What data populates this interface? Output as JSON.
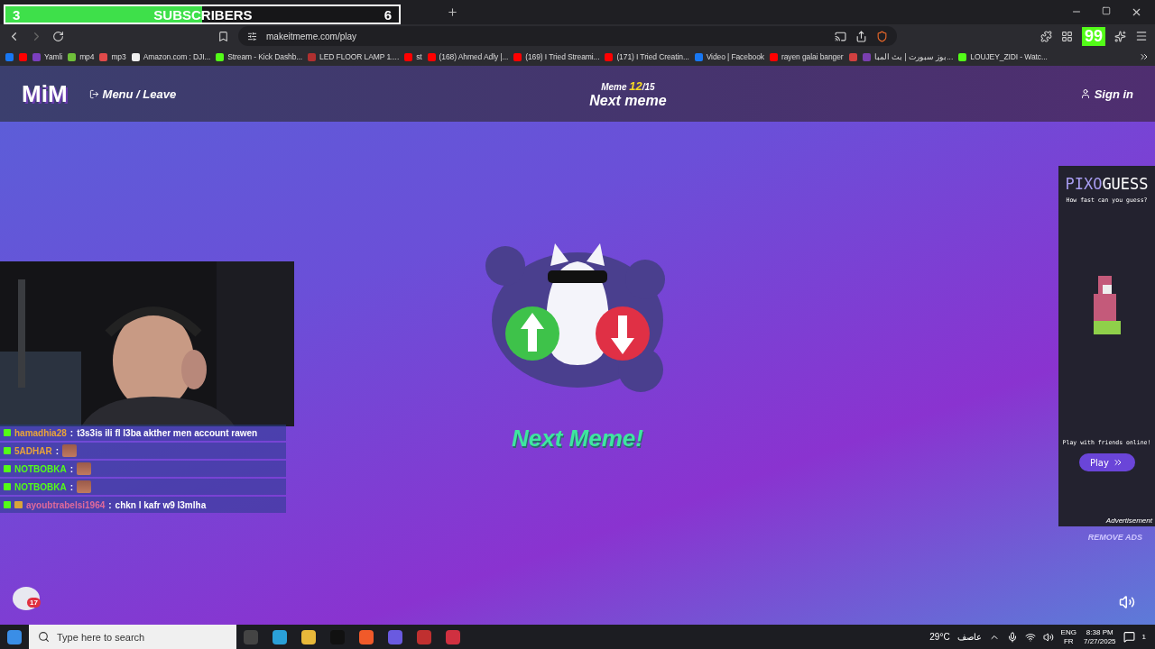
{
  "subscriber_goal": {
    "current": "3",
    "label": "SUBSCRIBERS",
    "goal": "6",
    "level": 0.5
  },
  "browser": {
    "address": "makeitmeme.com/play",
    "extension_counter": "99",
    "bookmarks": [
      {
        "color": "#1877f2"
      },
      {
        "color": "#ff0000"
      },
      {
        "label": "Yamli",
        "color": "#7b3fbf"
      },
      {
        "label": "mp4",
        "color": "#6fbf3a"
      },
      {
        "label": "mp3",
        "color": "#e04a4a"
      },
      {
        "label": "Amazon.com : DJI...",
        "color": "#f0f0f0"
      },
      {
        "label": "Stream - Kick Dashb...",
        "color": "#53fc18"
      },
      {
        "label": "LED FLOOR LAMP 1....",
        "color": "#b03030"
      },
      {
        "label": "st",
        "color": "#ff0000"
      },
      {
        "label": "(168) Ahmed Adly |...",
        "color": "#ff0000"
      },
      {
        "label": "(169) I Tried Streami...",
        "color": "#ff0000"
      },
      {
        "label": "(171) I Tried Creatin...",
        "color": "#ff0000"
      },
      {
        "label": "Video | Facebook",
        "color": "#1877f2"
      },
      {
        "label": "rayen galai banger",
        "color": "#ff0000"
      },
      {
        "color": "#d04040"
      },
      {
        "label": "بوز سبورت | بث المبا...",
        "color": "#7a3fb0"
      },
      {
        "label": "LOUJEY_ZIDI - Watc...",
        "color": "#53fc18"
      }
    ]
  },
  "header": {
    "logo": "MiM",
    "menu": "Menu / Leave",
    "counter_label": "Meme",
    "counter_current": "12",
    "counter_total": "/15",
    "title": "Next meme",
    "sign_in": "Sign in"
  },
  "main": {
    "next_button": "Next Meme!"
  },
  "ad": {
    "title_left": "PIXO",
    "title_right": "GUESS",
    "tagline": "How fast can you guess?",
    "cta": "Play with friends online!",
    "button": "Play",
    "footer": "Advertisement",
    "remove": "REMOVE ADS"
  },
  "chat": [
    {
      "user": "hamadhia28",
      "color": "#e8a33a",
      "vip": false,
      "separator": ":",
      "text": "t3s3is ili fl l3ba akther men account rawen",
      "emote": false
    },
    {
      "user": "5ADHAR",
      "color": "#e8a33a",
      "vip": false,
      "separator": ":",
      "emote": true
    },
    {
      "user": "NOTBOBKA",
      "color": "#53fc18",
      "vip": false,
      "separator": ":",
      "emote": true
    },
    {
      "user": "NOTBOBKA",
      "color": "#53fc18",
      "vip": false,
      "separator": ":",
      "emote": true
    },
    {
      "user": "ayoubtrabelsi1964",
      "color": "#e06a9a",
      "vip": true,
      "separator": ":",
      "text": "chkn l kafr w9 l3mlha",
      "emote": false
    }
  ],
  "chat_badge": "17",
  "taskbar": {
    "search": "Type here to search",
    "temperature": "29°C",
    "weather": "عاصف",
    "lang_top": "ENG",
    "lang_bottom": "FR",
    "time": "8:38 PM",
    "date": "7/27/2025",
    "notifications": "1"
  }
}
